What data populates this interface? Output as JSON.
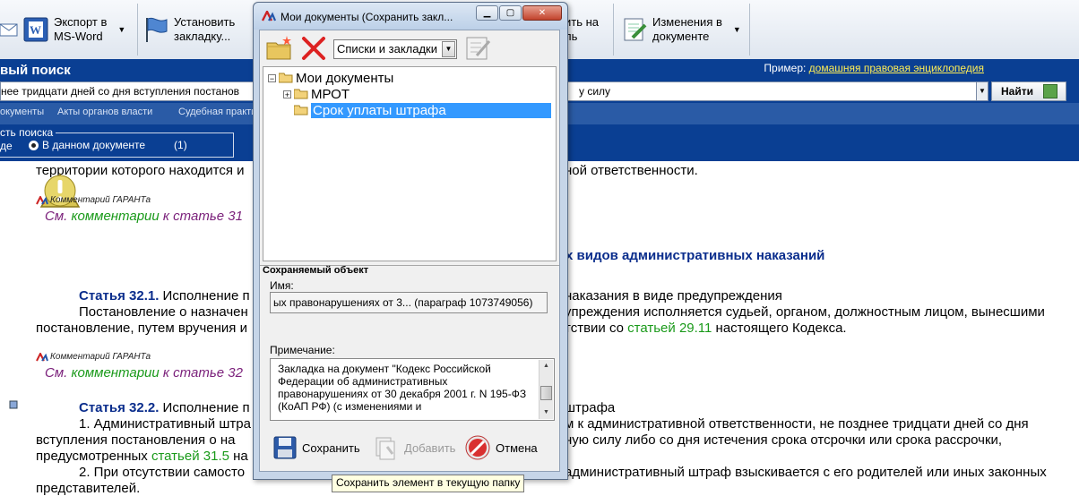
{
  "toolbar": {
    "items": [
      {
        "label": "Экспорт в\nMS-Word",
        "icon": "word-icon"
      },
      {
        "label": "Установить\nзакладку...",
        "icon": "flag-icon"
      },
      {
        "label": "ить на\nль",
        "icon": "print-icon"
      },
      {
        "label": "Изменения в\nдокументе",
        "icon": "document-changes-icon"
      }
    ]
  },
  "search": {
    "title": "вый поиск",
    "example_label": "Пример:",
    "example_link": "домашняя правовая энциклопедия",
    "query": "нее тридцати дней со дня вступления постанов",
    "query_tail": "у силу",
    "find_label": "Найти",
    "tabs": [
      "окументы",
      "Акты органов власти",
      "Судебная практи"
    ],
    "scope_legend": "сть поиска",
    "scope_option_a": "де",
    "scope_option_b": "В данном документе",
    "scope_count": "(1)"
  },
  "document": {
    "line1": "территории которого находится и",
    "line1_tail": "ной ответственности.",
    "comment_label": "Комментарий ГАРАНТа",
    "comment1_prefix": "См. ",
    "comment1_link": "комментарии",
    "comment1_suffix": " к статье 31",
    "heading_tail": "х видов административных наказаний",
    "art321_label": "Статья 32.1.",
    "art321_text": " Исполнение п",
    "art321_tail": " наказания в виде предупреждения",
    "p1_start": "Постановление о назначен",
    "p1_tail": "упреждения исполняется судьей, органом, должностным лицом, вынесшими",
    "p2_start": "постановление, путем вручения и",
    "p2_mid": "тствии со ",
    "p2_link": "статьей 29.11",
    "p2_end": " настоящего Кодекса.",
    "comment2_prefix": "См. ",
    "comment2_link": "комментарии",
    "comment2_suffix": " к статье 32",
    "art322_label": "Статья 32.2.",
    "art322_text": " Исполнение п",
    "art322_tail": "штрафа",
    "p3_start": "1. Административный штра",
    "p3_tail": "м к административной ответственности, не позднее тридцати дней со дня",
    "p4_start": "вступления постановления о на",
    "p4_tail": "ную силу либо со дня истечения срока отсрочки или срока рассрочки,",
    "p5_start": "предусмотренных ",
    "p5_link": "статьей 31.5",
    "p5_end": " на",
    "p6_start": "2. При отсутствии самосто",
    "p6_tail": "административный штраф взыскивается с его родителей или иных законных",
    "p7": "представителей."
  },
  "dialog": {
    "title": "Мои документы (Сохранить закл...",
    "combo_value": "Списки и закладки",
    "tree": {
      "root": "Мои документы",
      "child1": "МРОТ",
      "child2": "Срок уплаты штрафа"
    },
    "group_title": "Сохраняемый объект",
    "name_label": "Имя:",
    "name_value": "ых правонарушениях от 3... (параграф 1073749056)",
    "note_label": "Примечание:",
    "note_value": "Закладка на документ \"Кодекс Российской Федерации об административных правонарушениях от 30 декабря 2001 г. N 195-ФЗ (КоАП РФ) (с изменениями и",
    "save_label": "Сохранить",
    "add_label": "Добавить",
    "cancel_label": "Отмена",
    "tooltip": "Сохранить элемент в текущую папку"
  },
  "colors": {
    "band": "#0a3f93",
    "selection": "#3399ff",
    "link": "#1a9a1a",
    "comment": "#7a1f7a",
    "heading": "#0a2d8c"
  }
}
